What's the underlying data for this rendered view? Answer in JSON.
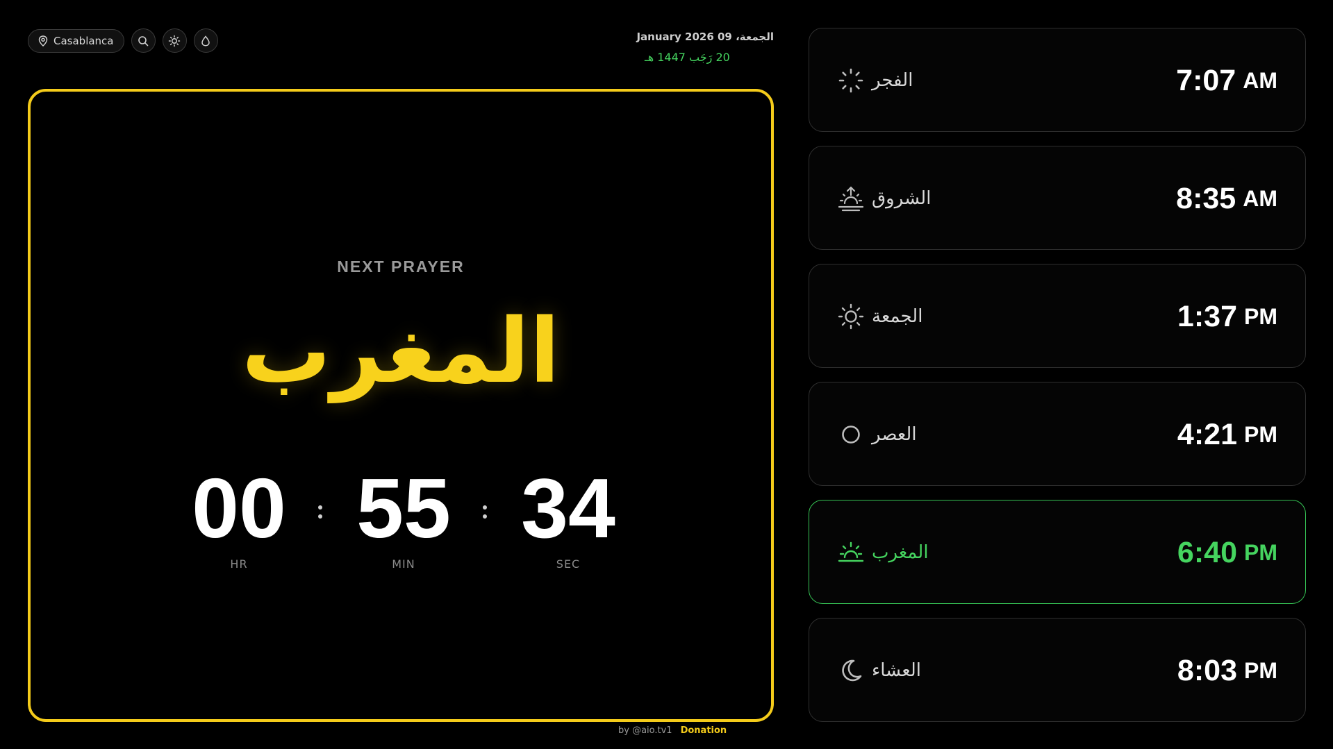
{
  "header": {
    "location": "Casablanca",
    "gregorian_date": "الجمعة، 09 January 2026",
    "hijri_date": "20 رَجَب 1447 هـ"
  },
  "icons": {
    "location": "map-pin-icon",
    "search": "search-icon",
    "theme": "sun-icon",
    "drop": "water-drop-icon"
  },
  "next_prayer": {
    "label": "NEXT PRAYER",
    "name": "المغرب",
    "countdown": {
      "hours": "00",
      "minutes": "55",
      "seconds": "34",
      "hours_label": "HR",
      "minutes_label": "MIN",
      "seconds_label": "SEC"
    }
  },
  "prayers": [
    {
      "name": "الفجر",
      "time": "7:07",
      "period": "AM",
      "icon": "fajr-dawn-icon",
      "active": false
    },
    {
      "name": "الشروق",
      "time": "8:35",
      "period": "AM",
      "icon": "sunrise-icon",
      "active": false
    },
    {
      "name": "الجمعة",
      "time": "1:37",
      "period": "PM",
      "icon": "sun-icon",
      "active": false
    },
    {
      "name": "العصر",
      "time": "4:21",
      "period": "PM",
      "icon": "circle-icon",
      "active": false
    },
    {
      "name": "المغرب",
      "time": "6:40",
      "period": "PM",
      "icon": "sunset-icon",
      "active": true
    },
    {
      "name": "العشاء",
      "time": "8:03",
      "period": "PM",
      "icon": "moon-icon",
      "active": false
    }
  ],
  "footer": {
    "by": "by @aio.tv1",
    "donation": "Donation"
  },
  "colors": {
    "accent_yellow": "#f4cb1a",
    "active_green": "#45d45f",
    "background": "#000000"
  }
}
